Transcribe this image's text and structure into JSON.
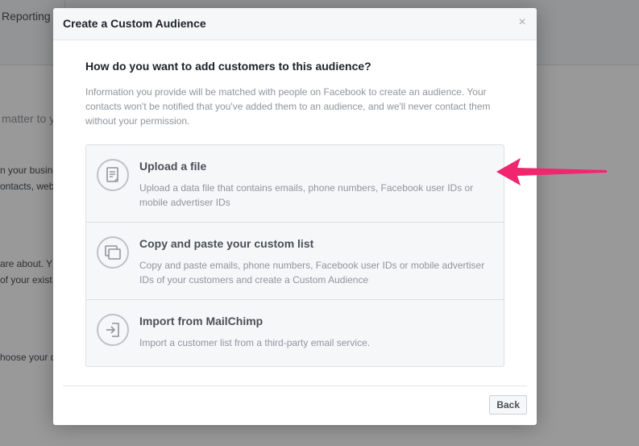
{
  "background": {
    "tab_reporting": "Reporting",
    "fragments": [
      "matter to yo",
      "n your busin",
      "ontacts, webs",
      "are about. Y",
      "of your exist",
      "hoose your d"
    ]
  },
  "modal": {
    "title": "Create a Custom Audience",
    "close_label": "×",
    "question": "How do you want to add customers to this audience?",
    "info": "Information you provide will be matched with people on Facebook to create an audience. Your contacts won't be notified that you've added them to an audience, and we'll never contact them without your permission.",
    "options": [
      {
        "title": "Upload a file",
        "description": "Upload a data file that contains emails, phone numbers, Facebook user IDs or mobile advertiser IDs",
        "icon": "file-icon"
      },
      {
        "title": "Copy and paste your custom list",
        "description": "Copy and paste emails, phone numbers, Facebook user IDs or mobile advertiser IDs of your customers and create a Custom Audience",
        "icon": "copy-icon"
      },
      {
        "title": "Import from MailChimp",
        "description": "Import a customer list from a third-party email service.",
        "icon": "import-icon"
      }
    ],
    "back_label": "Back"
  },
  "colors": {
    "annotation_arrow": "#f0266f",
    "overlay": "rgba(0,0,0,0.4)"
  }
}
